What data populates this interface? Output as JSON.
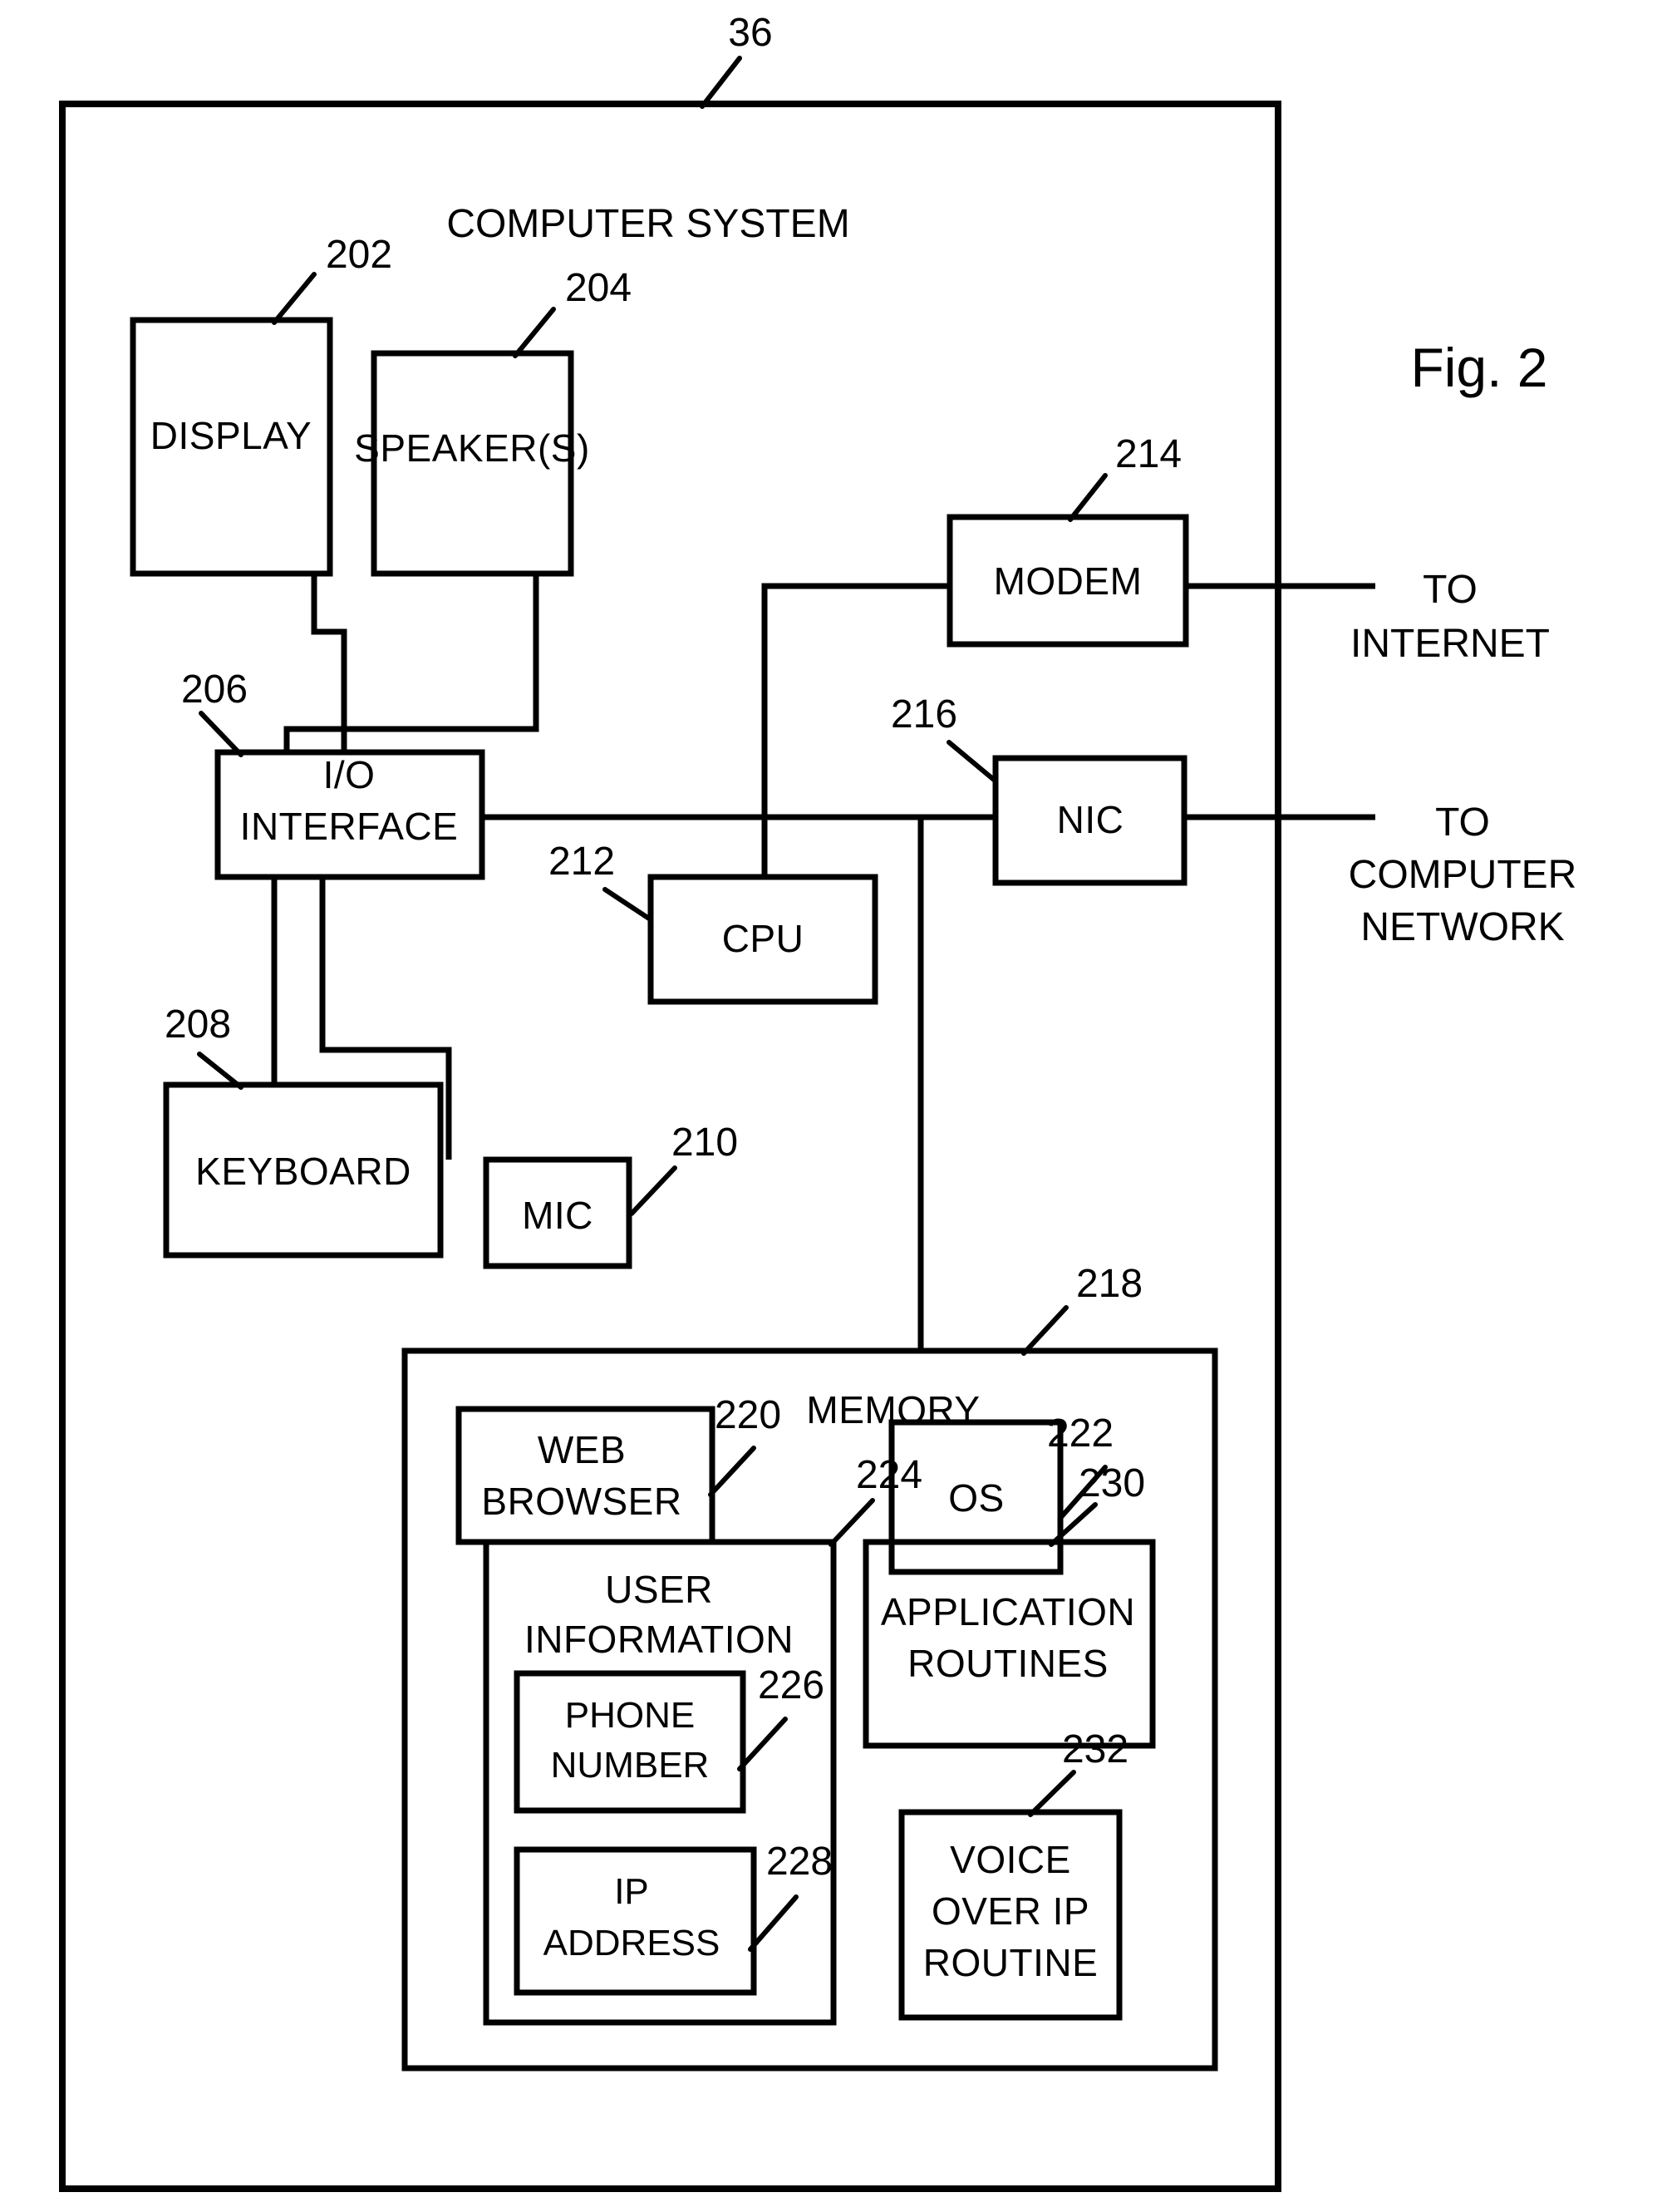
{
  "figure": {
    "fig_label": "Fig. 2",
    "system_ref": "36",
    "system_title": "COMPUTER SYSTEM"
  },
  "blocks": {
    "display": {
      "label": "DISPLAY",
      "ref": "202"
    },
    "speakers": {
      "label": "SPEAKER(S)",
      "ref": "204"
    },
    "io_interface": {
      "label_line1": "I/O",
      "label_line2": "INTERFACE",
      "ref": "206"
    },
    "keyboard": {
      "label": "KEYBOARD",
      "ref": "208"
    },
    "mic": {
      "label": "MIC",
      "ref": "210"
    },
    "cpu": {
      "label": "CPU",
      "ref": "212"
    },
    "modem": {
      "label": "MODEM",
      "ref": "214"
    },
    "nic": {
      "label": "NIC",
      "ref": "216"
    },
    "memory": {
      "label": "MEMORY",
      "ref": "218"
    },
    "web_browser": {
      "label_line1": "WEB",
      "label_line2": "BROWSER",
      "ref": "220"
    },
    "os": {
      "label": "OS",
      "ref": "222"
    },
    "user_information": {
      "label_line1": "USER",
      "label_line2": "INFORMATION",
      "ref": "224"
    },
    "phone_number": {
      "label_line1": "PHONE",
      "label_line2": "NUMBER",
      "ref": "226"
    },
    "ip_address": {
      "label_line1": "IP",
      "label_line2": "ADDRESS",
      "ref": "228"
    },
    "application_routines": {
      "label_line1": "APPLICATION",
      "label_line2": "ROUTINES",
      "ref": "230"
    },
    "voice_over_ip_routine": {
      "label_line1": "VOICE",
      "label_line2": "OVER IP",
      "label_line3": "ROUTINE",
      "ref": "232"
    }
  },
  "external_links": {
    "to_internet_line1": "TO",
    "to_internet_line2": "INTERNET",
    "to_network_line1": "TO",
    "to_network_line2": "COMPUTER",
    "to_network_line3": "NETWORK"
  },
  "colors": {
    "ink": "#000000",
    "paper": "#ffffff"
  }
}
